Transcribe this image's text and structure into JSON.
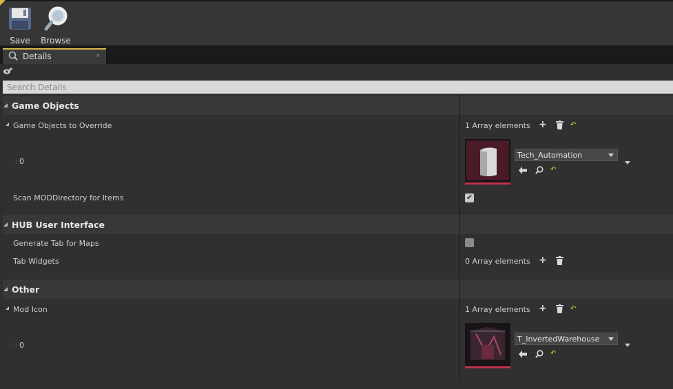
{
  "toolbar": {
    "save_label": "Save",
    "browse_label": "Browse"
  },
  "tab": {
    "label": "Details",
    "close": "×"
  },
  "search": {
    "placeholder": "Search Details"
  },
  "categories": [
    {
      "label": "Game Objects",
      "rows": [
        {
          "label": "Game Objects to Override",
          "array_count": "1 Array elements"
        },
        {
          "index": "0",
          "asset_name": "Tech_Automation"
        },
        {
          "label": "Scan MODDirectory for Items",
          "checked": true
        }
      ]
    },
    {
      "label": "HUB User Interface",
      "rows": [
        {
          "label": "Generate Tab for Maps",
          "checked": false
        },
        {
          "label": "Tab Widgets",
          "array_count": "0 Array elements"
        }
      ]
    },
    {
      "label": "Other",
      "rows": [
        {
          "label": "Mod Icon",
          "array_count": "1 Array elements"
        },
        {
          "index": "0",
          "asset_name": "T_InvertedWarehouse"
        }
      ]
    }
  ],
  "glyphs": {
    "add": "+",
    "reset": "↶",
    "check": "✔",
    "grip": "⋮⋮"
  },
  "colors": {
    "accent_yellow": "#d8b84a",
    "asset_bar": "#c2304e",
    "reset_yellow": "#e6d43a"
  }
}
